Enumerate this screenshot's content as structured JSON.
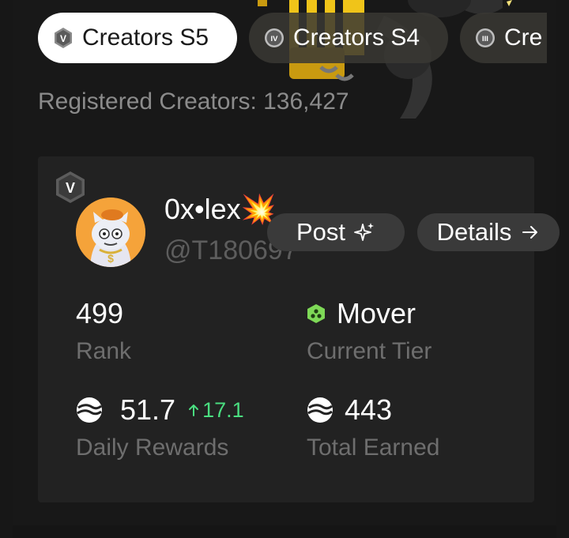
{
  "tabs": [
    {
      "label": "Creators S5",
      "badge": "V",
      "active": true
    },
    {
      "label": "Creators S4",
      "badge": "IV",
      "active": false
    },
    {
      "label": "Cre",
      "badge": "III",
      "active": false
    }
  ],
  "registered": {
    "label": "Registered Creators: 136,427"
  },
  "profile": {
    "tier_badge": "V",
    "display_name": "0x•lex",
    "name_emoji": "💥",
    "handle": "@T180697",
    "avatar_icon": "cat-avatar"
  },
  "actions": {
    "post_label": "Post",
    "post_icon": "sparkle-icon",
    "details_label": "Details",
    "details_icon": "arrow-right-icon"
  },
  "stats": {
    "rank_value": "499",
    "rank_label": "Rank",
    "tier_value": "Mover",
    "tier_label": "Current Tier",
    "daily_value": "51.7",
    "daily_delta": "17.1",
    "daily_label": "Daily Rewards",
    "total_value": "443",
    "total_label": "Total Earned"
  },
  "colors": {
    "background": "#171717",
    "card": "#222222",
    "muted_text": "#8b8b8b",
    "positive": "#4ade80",
    "tier_green": "#7ed957"
  }
}
